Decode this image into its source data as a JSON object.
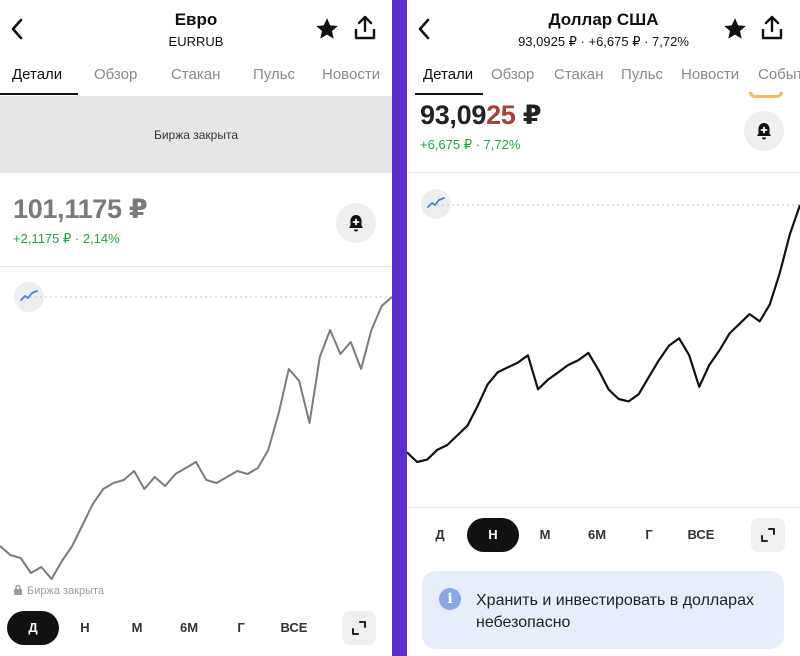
{
  "colors": {
    "divider": "#5b2fc9",
    "positive_change": "#1fa543",
    "active_period_bg": "#111111",
    "info_card_bg": "#e6eefb",
    "price_highlight": "#a8413b"
  },
  "left": {
    "header": {
      "title": "Евро",
      "subtitle": "EURRUB"
    },
    "tabs": [
      "Детали",
      "Обзор",
      "Стакан",
      "Пульс",
      "Новости"
    ],
    "active_tab": "Детали",
    "banner": "Биржа закрыта",
    "price": "101,1175 ₽",
    "change": "+2,1175 ₽ · 2,14%",
    "chart_footer": "Биржа закрыта",
    "periods": [
      "Д",
      "Н",
      "М",
      "6М",
      "Г",
      "ВСЕ"
    ],
    "active_period": "Д",
    "icons": [
      "back-icon",
      "star-icon",
      "share-icon",
      "bell-plus-icon",
      "trend-icon",
      "lock-icon",
      "expand-icon"
    ]
  },
  "right": {
    "header": {
      "title": "Доллар США",
      "subtitle": "93,0925 ₽ · +6,675 ₽ · 7,72%"
    },
    "tabs": [
      "Детали",
      "Обзор",
      "Стакан",
      "Пульс",
      "Новости",
      "Событ"
    ],
    "active_tab": "Детали",
    "price_main": "93,09",
    "price_highlight": "25",
    "price_currency": " ₽",
    "change": "+6,675 ₽ · 7,72%",
    "periods": [
      "Д",
      "Н",
      "М",
      "6М",
      "Г",
      "ВСЕ"
    ],
    "active_period": "Н",
    "info": "Хранить и инвестировать в долларах небезопасно",
    "icons": [
      "back-icon",
      "star-icon",
      "share-icon",
      "bell-plus-icon",
      "trend-icon",
      "expand-icon",
      "info-icon"
    ]
  },
  "chart_data": [
    {
      "type": "line",
      "series": [
        {
          "values": [
            1.3,
            1.0,
            0.9,
            0.4,
            0.6,
            0.2,
            0.8,
            1.3,
            2.0,
            2.7,
            3.2,
            3.4,
            3.5,
            3.8,
            3.2,
            3.6,
            3.3,
            3.7,
            3.9,
            4.1,
            3.5,
            3.4,
            3.6,
            3.8,
            3.7,
            3.9,
            4.5,
            5.7,
            7.2,
            6.8,
            5.4,
            7.6,
            8.5,
            7.7,
            8.1,
            7.2,
            8.5,
            9.3,
            9.6
          ]
        }
      ]
    },
    {
      "type": "line",
      "series": [
        {
          "values": [
            1.2,
            0.8,
            0.9,
            1.3,
            1.5,
            1.9,
            2.3,
            3.1,
            4.0,
            4.5,
            4.7,
            4.9,
            5.2,
            3.8,
            4.2,
            4.5,
            4.8,
            5.0,
            5.3,
            4.6,
            3.8,
            3.4,
            3.3,
            3.6,
            4.3,
            5.0,
            5.6,
            5.9,
            5.2,
            3.9,
            4.8,
            5.4,
            6.1,
            6.5,
            6.9,
            6.6,
            7.3,
            8.6,
            10.2,
            11.4
          ]
        }
      ]
    }
  ]
}
